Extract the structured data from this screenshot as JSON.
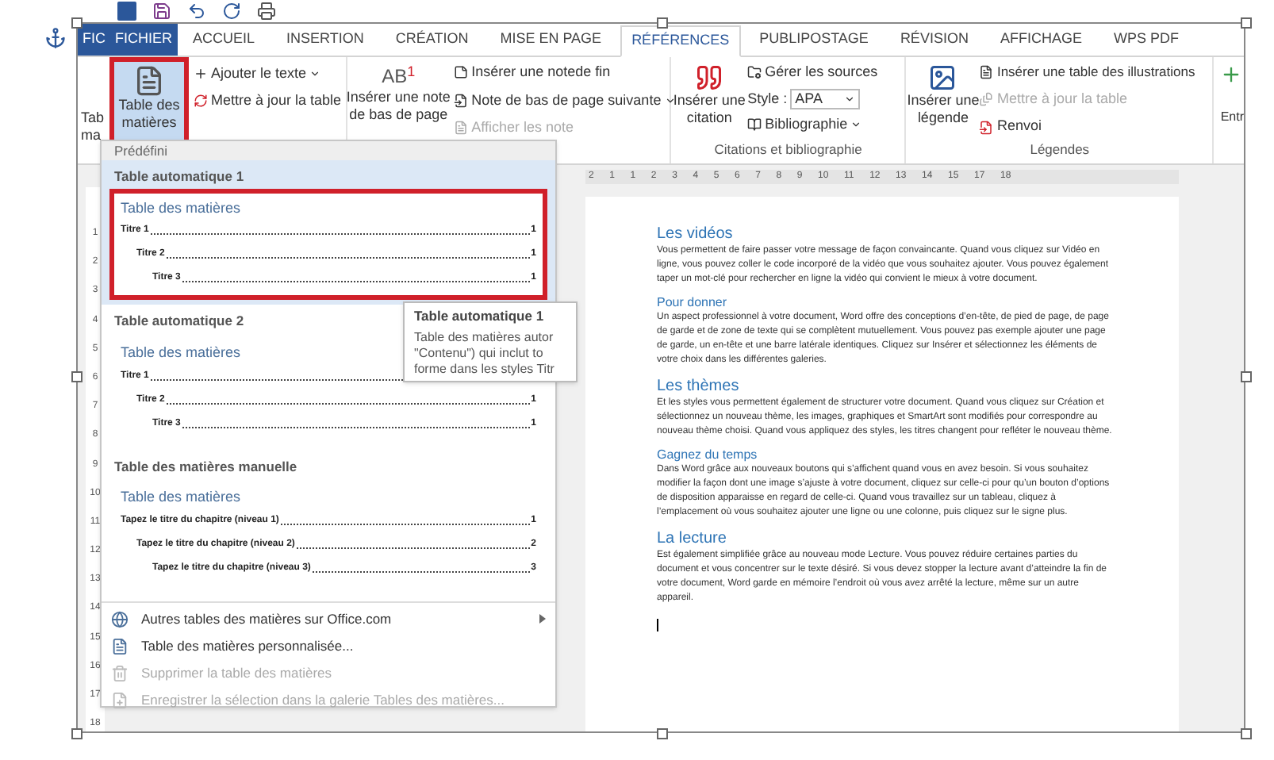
{
  "tabs": [
    {
      "label": "FIC",
      "kind": "file",
      "selected": false
    },
    {
      "label": "FICHIER",
      "kind": "file",
      "selected": false
    },
    {
      "label": "ACCUEIL",
      "kind": "tab",
      "selected": false
    },
    {
      "label": "INSERTION",
      "kind": "tab",
      "selected": false
    },
    {
      "label": "CRÉATION",
      "kind": "tab",
      "selected": false
    },
    {
      "label": "MISE EN PAGE",
      "kind": "tab",
      "selected": false
    },
    {
      "label": "RÉFÉRENCES",
      "kind": "tab",
      "selected": true
    },
    {
      "label": "PUBLIPOSTAGE",
      "kind": "tab",
      "selected": false
    },
    {
      "label": "RÉVISION",
      "kind": "tab",
      "selected": false
    },
    {
      "label": "AFFICHAGE",
      "kind": "tab",
      "selected": false
    },
    {
      "label": "WPS PDF",
      "kind": "tab",
      "selected": false
    }
  ],
  "ribbon": {
    "toc": {
      "cut_lines": [
        "Tab",
        "ma"
      ],
      "button": {
        "lines": [
          "Table des",
          "matières"
        ],
        "selected": true,
        "annotated": true
      },
      "add_text": "Ajouter le texte",
      "update_table": "Mettre à jour la table"
    },
    "footnotes": {
      "icon_text": "AB",
      "icon_sup": "1",
      "insert_note": [
        "Insérer une note",
        "de bas de page"
      ],
      "endnote": "Insérer une notede fin",
      "next_note": "Note de bas de page suivante",
      "show_notes": {
        "label": "Afficher les note",
        "disabled": true
      }
    },
    "citations": {
      "insert_citation": [
        "Insérer une",
        "citation"
      ],
      "manage": "Gérer les sources",
      "style_label": "Style :",
      "style_value": "APA",
      "bibliography": "Bibliographie",
      "label": "Citations et bibliographie"
    },
    "captions": {
      "insert_caption": [
        "Insérer une",
        "légende"
      ],
      "insert_table": "Insérer une table des illustrations",
      "update": {
        "label": "Mettre à jour la table",
        "disabled": true
      },
      "crossref": "Renvoi",
      "label": "Légendes"
    },
    "cut_group": {
      "label": "Entr"
    }
  },
  "dropdown": {
    "header": "Prédéfini",
    "gallery": [
      {
        "title": "Table automatique 1",
        "selected": true,
        "annotated": true,
        "preview_title": "Table des matières",
        "entries": [
          {
            "text": "Titre 1",
            "page": "1",
            "children": [
              {
                "text": "Titre 2",
                "page": "1",
                "children": [
                  {
                    "text": "Titre 3",
                    "page": "1"
                  }
                ]
              }
            ]
          }
        ]
      },
      {
        "title": "Table automatique 2",
        "selected": false,
        "annotated": false,
        "preview_title": "Table des matières",
        "entries": [
          {
            "text": "Titre 1",
            "children": [
              {
                "text": "Titre 2",
                "page": "1",
                "children": [
                  {
                    "text": "Titre 3",
                    "page": "1"
                  }
                ]
              }
            ]
          }
        ]
      },
      {
        "title": "Table des matières manuelle",
        "selected": false,
        "annotated": false,
        "preview_title": "Table des matières",
        "entries": [
          {
            "text": "Tapez le titre du chapitre (niveau 1)",
            "page": "1",
            "children": [
              {
                "text": "Tapez le titre du chapitre (niveau 2)",
                "page": "2",
                "children": [
                  {
                    "text": "Tapez le titre du chapitre (niveau 3)",
                    "page": "3"
                  }
                ]
              }
            ]
          }
        ]
      }
    ],
    "commands": [
      {
        "label": "Autres tables des matières sur Office.com",
        "kind": "web",
        "disabled": false,
        "submenu": true
      },
      {
        "label": "Table des matières personnalisée...",
        "kind": "custom",
        "disabled": false,
        "submenu": false
      },
      {
        "label": "Supprimer la table des matières",
        "kind": "remove",
        "disabled": true,
        "submenu": false
      },
      {
        "label": "Enregistrer la sélection dans la galerie Tables des matières...",
        "kind": "save",
        "disabled": true,
        "submenu": false
      }
    ]
  },
  "tooltip": {
    "title": "Table automatique 1",
    "lines": [
      "Table des matières autor",
      "\"Contenu\") qui inclut to",
      "forme dans les styles Titr"
    ]
  },
  "vertical_ruler": [
    "1",
    "2",
    "3",
    "4",
    "5",
    "6",
    "7",
    "8",
    "9",
    "10",
    "11",
    "12",
    "13",
    "14",
    "15",
    "16",
    "17",
    "18"
  ],
  "horizontal_ruler": [
    "2",
    "1",
    "1",
    "2",
    "3",
    "4",
    "5",
    "6",
    "7",
    "8",
    "9",
    "10",
    "11",
    "12",
    "13",
    "14",
    "15",
    "17",
    "18"
  ],
  "document": [
    {
      "kind": "heading1",
      "text": "Les vidéos"
    },
    {
      "kind": "paragraph",
      "text": "Vous permettent de faire passer votre message de façon convaincante. Quand vous cliquez sur Vidéo en ligne, vous pouvez coller le code incorporé de la vidéo que vous souhaitez ajouter. Vous pouvez également taper un mot-clé pour rechercher en ligne la vidéo qui convient le mieux à votre document."
    },
    {
      "kind": "heading2",
      "text": "Pour donner"
    },
    {
      "kind": "paragraph",
      "text": "Un aspect professionnel à votre document, Word offre des conceptions d’en-tête, de pied de page, de page de garde et de zone de texte qui se complètent mutuellement. Vous pouvez pas exemple ajouter une page de garde, un en-tête et une barre latérale identiques. Cliquez sur Insérer et sélectionnez les éléments de votre choix dans les différentes galeries."
    },
    {
      "kind": "heading1",
      "text": "Les thèmes"
    },
    {
      "kind": "paragraph",
      "text": "Et les styles vous permettent également de structurer votre document. Quand vous cliquez sur Création et sélectionnez un nouveau thème, les images, graphiques et SmartArt sont modifiés pour correspondre au nouveau thème choisi. Quand vous appliquez des styles, les titres changent pour refléter le nouveau thème."
    },
    {
      "kind": "heading2",
      "text": "Gagnez du temps"
    },
    {
      "kind": "paragraph",
      "text": "Dans Word grâce aux nouveaux boutons qui s’affichent quand vous en avez besoin. Si vous souhaitez modifier la façon dont une image s’ajuste à votre document, cliquez sur celle-ci pour qu’un bouton d’options de disposition apparaisse en regard de celle-ci. Quand vous travaillez sur un tableau, cliquez à l’emplacement où vous souhaitez ajouter une ligne ou une colonne, puis cliquez sur le signe plus."
    },
    {
      "kind": "heading1",
      "text": "La lecture"
    },
    {
      "kind": "paragraph",
      "text": "Est également simplifiée grâce au nouveau mode Lecture. Vous pouvez réduire certaines parties du document et vous concentrer sur le texte désiré. Si vous devez stopper la lecture avant d’atteindre la fin de votre document, Word garde en mémoire l’endroit où vous avez arrêté la lecture, même sur un autre appareil."
    }
  ]
}
